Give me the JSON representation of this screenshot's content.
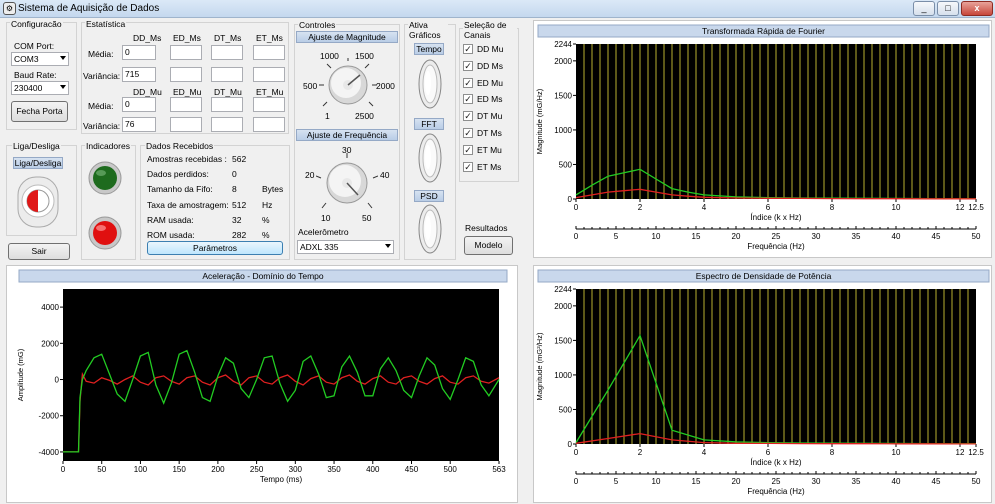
{
  "window": {
    "title": "Sistema de Aquisição de Dados",
    "minimize": "_",
    "maximize": "□",
    "close": "x"
  },
  "config": {
    "group": "Configuracão",
    "com_label": "COM Port:",
    "com_value": "COM3",
    "baud_label": "Baud Rate:",
    "baud_value": "230400",
    "close_port": "Fecha Porta"
  },
  "stats": {
    "group": "Estatística",
    "ms_headers": [
      "DD_Ms",
      "ED_Ms",
      "DT_Ms",
      "ET_Ms"
    ],
    "mu_headers": [
      "DD_Mu",
      "ED_Mu",
      "DT_Mu",
      "ET_Mu"
    ],
    "media_label": "Média:",
    "variancia_label": "Variância:",
    "ms_media": [
      "0",
      "",
      "",
      ""
    ],
    "ms_var": [
      "715",
      "",
      "",
      ""
    ],
    "mu_media": [
      "0",
      "",
      "",
      ""
    ],
    "mu_var": [
      "76",
      "",
      "",
      ""
    ]
  },
  "controls": {
    "group": "Controles",
    "mag_title": "Ajuste de Magnitude",
    "mag_ticks": [
      "1000",
      "1500",
      "500",
      "2000",
      "1",
      "2500"
    ],
    "freq_title": "Ajuste de Frequência",
    "freq_ticks": [
      "30",
      "20",
      "40",
      "10",
      "50"
    ],
    "accel_label": "Acelerômetro",
    "accel_value": "ADXL 335"
  },
  "graphs": {
    "group": "Ativa Gráficos",
    "tempo": "Tempo",
    "fft": "FFT",
    "psd": "PSD"
  },
  "channels": {
    "group": "Seleção de Canais",
    "items": [
      "DD Mu",
      "DD Ms",
      "ED Mu",
      "ED Ms",
      "DT Mu",
      "DT Ms",
      "ET Mu",
      "ET Ms"
    ],
    "check": "✓"
  },
  "onoff": {
    "group": "Liga/Desliga",
    "button": "Liga/Desliga"
  },
  "exit": {
    "label": "Sair"
  },
  "indicators": {
    "group": "Indicadores",
    "colors": {
      "green": "#1e6b1e",
      "red": "#e01010"
    }
  },
  "received": {
    "group": "Dados Recebidos",
    "rows": [
      {
        "label": "Amostras recebidas :",
        "value": "562",
        "unit": ""
      },
      {
        "label": "Dados perdidos:",
        "value": "0",
        "unit": ""
      },
      {
        "label": "Tamanho da Fifo:",
        "value": "8",
        "unit": "Bytes"
      },
      {
        "label": "Taxa de amostragem:",
        "value": "512",
        "unit": "Hz"
      },
      {
        "label": "RAM usada:",
        "value": "32",
        "unit": "%"
      },
      {
        "label": "ROM usada:",
        "value": "282",
        "unit": "%"
      }
    ],
    "params_button": "Parâmetros"
  },
  "results": {
    "label": "Resultados",
    "model_button": "Modelo"
  },
  "chart_data": [
    {
      "type": "line",
      "title": "Aceleração - Domínio do Tempo",
      "xlabel": "Tempo (ms)",
      "ylabel": "Amplitude (mG)",
      "xlim": [
        0,
        563
      ],
      "ylim": [
        -4500,
        5000
      ],
      "xticks": [
        "0",
        "50",
        "100",
        "150",
        "200",
        "250",
        "300",
        "350",
        "400",
        "450",
        "500",
        "563"
      ],
      "yticks": [
        "4000",
        "2000",
        "0",
        "-2000",
        "-4000"
      ],
      "series": [
        {
          "color": "#e02020",
          "x": [
            0,
            15,
            20,
            22,
            25,
            30,
            40,
            50,
            60,
            70,
            80,
            90,
            100,
            110,
            120,
            130,
            140,
            150,
            160,
            170,
            180,
            190,
            200,
            210,
            220,
            230,
            240,
            250,
            260,
            270,
            280,
            290,
            300,
            310,
            320,
            330,
            340,
            350,
            360,
            370,
            380,
            390,
            400,
            410,
            420,
            430,
            440,
            450,
            460,
            470,
            480,
            490,
            500,
            510,
            520,
            530,
            540,
            550,
            563
          ],
          "y": [
            -4000,
            -4000,
            -4000,
            -1200,
            300,
            -100,
            -200,
            100,
            -50,
            -250,
            0,
            200,
            -150,
            -300,
            100,
            200,
            -100,
            -250,
            100,
            200,
            -150,
            -300,
            100,
            250,
            -100,
            -300,
            100,
            200,
            -150,
            -250,
            100,
            250,
            -100,
            -300,
            50,
            200,
            -150,
            -250,
            100,
            250,
            -100,
            -250,
            50,
            200,
            -150,
            -250,
            100,
            200,
            -100,
            -250,
            50,
            200,
            -150,
            -250,
            100,
            200,
            -100,
            -200,
            100
          ]
        },
        {
          "color": "#22cc22",
          "x": [
            0,
            15,
            20,
            22,
            25,
            30,
            40,
            50,
            60,
            70,
            80,
            90,
            100,
            110,
            120,
            130,
            140,
            150,
            160,
            170,
            180,
            190,
            200,
            210,
            220,
            230,
            240,
            250,
            260,
            270,
            280,
            290,
            300,
            310,
            320,
            330,
            340,
            350,
            360,
            370,
            380,
            390,
            400,
            410,
            420,
            430,
            440,
            450,
            460,
            470,
            480,
            490,
            500,
            510,
            520,
            530,
            540,
            550,
            563
          ],
          "y": [
            -4000,
            -4000,
            -4000,
            -1000,
            0,
            500,
            1200,
            1400,
            300,
            -800,
            -1200,
            0,
            1300,
            1500,
            -300,
            -1300,
            -200,
            1400,
            1600,
            400,
            -1000,
            -1200,
            200,
            1200,
            900,
            -500,
            -1000,
            0,
            1200,
            1300,
            -200,
            -1200,
            -600,
            1000,
            1300,
            300,
            -1000,
            -900,
            700,
            1300,
            400,
            -900,
            -900,
            600,
            1200,
            500,
            -600,
            -1000,
            200,
            1200,
            800,
            -500,
            -1100,
            0,
            1200,
            1000,
            -300,
            -900,
            0
          ]
        }
      ]
    },
    {
      "type": "line",
      "title": "Transformada Rápida de Fourier",
      "xlabel": "Índice (k x Hz)",
      "xlabel2": "Frequência (Hz)",
      "ylabel": "Magnitude (mG/Hz)",
      "xlim": [
        0,
        12.5
      ],
      "ylim": [
        0,
        2244
      ],
      "xticks": [
        "0",
        "2",
        "4",
        "6",
        "8",
        "10",
        "12",
        "12.5"
      ],
      "x2ticks": [
        "0",
        "5",
        "10",
        "15",
        "20",
        "25",
        "30",
        "35",
        "40",
        "45",
        "50"
      ],
      "yticks": [
        "2244",
        "2000",
        "1500",
        "1000",
        "500",
        "0"
      ],
      "series": [
        {
          "color": "#22cc22",
          "x": [
            0,
            0.5,
            1,
            1.5,
            2,
            2.5,
            3,
            3.5,
            4,
            5,
            6,
            7,
            8,
            9,
            10,
            11,
            12,
            12.5
          ],
          "y": [
            60,
            200,
            330,
            380,
            430,
            290,
            150,
            100,
            60,
            30,
            20,
            15,
            12,
            10,
            8,
            6,
            5,
            5
          ]
        },
        {
          "color": "#e02020",
          "x": [
            0,
            0.5,
            1,
            1.5,
            2,
            2.5,
            3,
            3.5,
            4,
            5,
            6,
            7,
            8,
            9,
            10,
            11,
            12,
            12.5
          ],
          "y": [
            20,
            60,
            100,
            120,
            140,
            100,
            60,
            40,
            25,
            15,
            10,
            8,
            6,
            5,
            4,
            3,
            3,
            3
          ]
        }
      ]
    },
    {
      "type": "line",
      "title": "Espectro de Densidade de Potência",
      "xlabel": "Índice (k x Hz)",
      "xlabel2": "Frequência (Hz)",
      "ylabel": "Magnitude (mG²/Hz)",
      "xlim": [
        0,
        12.5
      ],
      "ylim": [
        0,
        2244
      ],
      "xticks": [
        "0",
        "2",
        "4",
        "6",
        "8",
        "10",
        "12",
        "12.5"
      ],
      "x2ticks": [
        "0",
        "5",
        "10",
        "15",
        "20",
        "25",
        "30",
        "35",
        "40",
        "45",
        "50"
      ],
      "yticks": [
        "2244",
        "2000",
        "1500",
        "1000",
        "500",
        "0"
      ],
      "series": [
        {
          "color": "#22cc22",
          "x": [
            0,
            1,
            2,
            3,
            4,
            5,
            6,
            7,
            8,
            9,
            10,
            11,
            12,
            12.5
          ],
          "y": [
            20,
            780,
            1570,
            200,
            60,
            30,
            20,
            15,
            12,
            10,
            8,
            6,
            5,
            5
          ]
        },
        {
          "color": "#e02020",
          "x": [
            0,
            1,
            2,
            3,
            4,
            5,
            6,
            7,
            8,
            9,
            10,
            11,
            12,
            12.5
          ],
          "y": [
            10,
            80,
            150,
            60,
            20,
            10,
            8,
            6,
            5,
            4,
            3,
            3,
            2,
            2
          ]
        }
      ]
    }
  ]
}
